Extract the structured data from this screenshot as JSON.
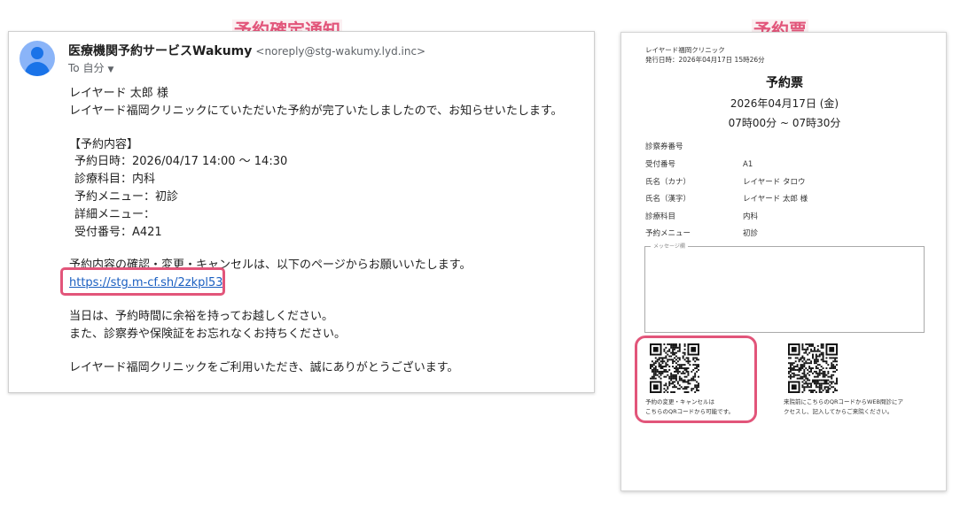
{
  "labels": {
    "notification": "予約確定通知",
    "ticket": "予約票"
  },
  "colors": {
    "highlight": "#e2557a",
    "link": "#1a5fc1",
    "avatar": "#1a73e8"
  },
  "email": {
    "sender_name": "医療機関予約サービスWakumy",
    "sender_address": "<noreply@stg-wakumy.lyd.inc>",
    "to_label": "To 自分",
    "greeting": "レイヤード 太郎 様",
    "intro": "レイヤード福岡クリニックにていただいた予約が完了いたしましたので、お知らせいたします。",
    "details_heading": "【予約内容】",
    "details": [
      "予約日時：2026/04/17 14:00 〜 14:30",
      "診療科目：内科",
      "予約メニュー：初診",
      "詳細メニュー：",
      "受付番号：A421"
    ],
    "link_intro": "予約内容の確認・変更・キャンセルは、以下のページからお願いいたします。",
    "link": "https://stg.m-cf.sh/2zkpl53",
    "notice1": "当日は、予約時間に余裕を持ってお越しください。",
    "notice2": "また、診察券や保険証をお忘れなくお持ちください。",
    "closing": "レイヤード福岡クリニックをご利用いただき、誠にありがとうございます。"
  },
  "ticket": {
    "clinic": "レイヤード福岡クリニック",
    "issued": "発行日時：2026年04月17日 15時26分",
    "title": "予約票",
    "date": "2026年04月17日 (金)",
    "time": "07時00分 ~ 07時30分",
    "rows": [
      {
        "label": "診察券番号",
        "value": ""
      },
      {
        "label": "受付番号",
        "value": "A1"
      },
      {
        "label": "氏名（カナ）",
        "value": "レイヤード タロウ"
      },
      {
        "label": "氏名（漢字）",
        "value": "レイヤード 太郎 様"
      },
      {
        "label": "診療科目",
        "value": "内科"
      },
      {
        "label": "予約メニュー",
        "value": "初診"
      }
    ],
    "message_label": "メッセージ欄",
    "qr1_caption_1": "予約の変更・キャンセルは",
    "qr1_caption_2": "こちらのQRコードから可能です。",
    "qr2_caption_1": "来院前にこちらのQRコードからWEB問診にア",
    "qr2_caption_2": "クセスし、記入してからご来院ください。"
  }
}
